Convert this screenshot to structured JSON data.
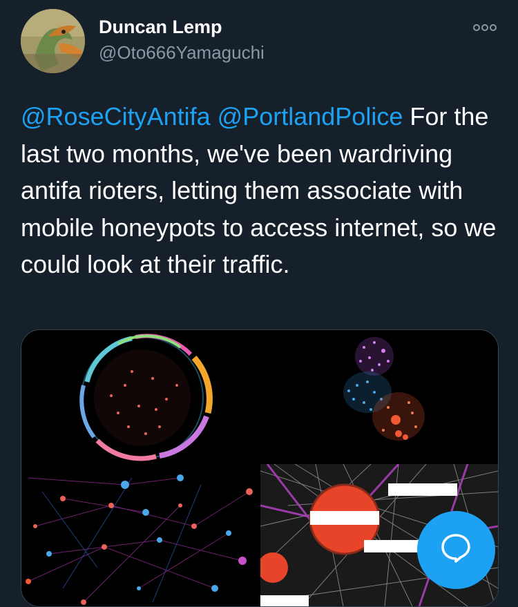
{
  "tweet": {
    "author": {
      "display_name": "Duncan Lemp",
      "handle": "@Oto666Yamaguchi",
      "avatar_icon": "avatar-image"
    },
    "text_segments": [
      {
        "text": "@RoseCityAntifa",
        "type": "mention"
      },
      {
        "text": " ",
        "type": "text"
      },
      {
        "text": "@PortlandPolice",
        "type": "mention"
      },
      {
        "text": " For the last two months, we've been wardriving antifa rioters, letting them associate with mobile honeypots to access internet, so we could look at their traffic.",
        "type": "text"
      }
    ],
    "more_icon": "more-options-icon",
    "media": [
      {
        "name": "network-graph-circular",
        "icon": "network-graph-image"
      },
      {
        "name": "network-graph-clusters",
        "icon": "network-graph-image"
      },
      {
        "name": "network-graph-nodes",
        "icon": "network-graph-image"
      },
      {
        "name": "network-graph-zoomed",
        "icon": "network-graph-image"
      }
    ]
  },
  "compose_button": {
    "icon": "speech-bubble-icon"
  },
  "colors": {
    "background": "#15202b",
    "text": "#ffffff",
    "secondary_text": "#8899a6",
    "mention": "#1da1f2",
    "accent": "#1da1f2"
  }
}
